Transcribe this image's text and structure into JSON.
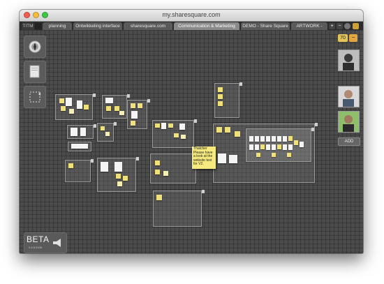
{
  "window": {
    "title": "my.sharesquare.com"
  },
  "tabs": [
    {
      "label": "TITM"
    },
    {
      "label": "planning"
    },
    {
      "label": "Ontwikkeling interface"
    },
    {
      "label": "sharesquare.com"
    },
    {
      "label": "Communication & Marketing",
      "active": true
    },
    {
      "label": "DEMO - Share Square"
    },
    {
      "label": "ARTWORK -"
    }
  ],
  "tab_buttons": {
    "add": "+",
    "remove": "−"
  },
  "sticky_note": {
    "text": "Thatcher Please have a look at the website text for V2."
  },
  "status": {
    "beta_label": "BETA",
    "version": "0.4.5.2109"
  },
  "participants": {
    "count": "70",
    "add_label": "ADD"
  },
  "colors": {
    "accent": "#e2c45a",
    "canvas": "#4b4b4b",
    "sticky": "#f0e07a"
  }
}
